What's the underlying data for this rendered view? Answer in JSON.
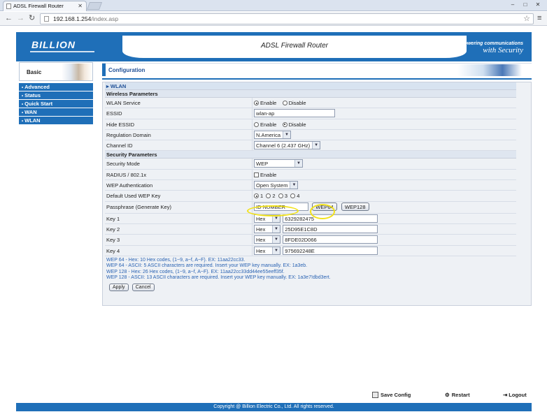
{
  "browser": {
    "tab_title": "ADSL Firewall Router",
    "url_host": "192.168.1.254",
    "url_path": "/index.asp"
  },
  "header": {
    "logo": "BILLION",
    "title": "ADSL Firewall Router",
    "slogan_line1": "Powering communications",
    "slogan_line2": "with Security"
  },
  "sidebar": {
    "title": "Basic",
    "items": [
      {
        "label": "Advanced"
      },
      {
        "label": "Status"
      },
      {
        "label": "Quick Start"
      },
      {
        "label": "WAN"
      },
      {
        "label": "WLAN"
      }
    ]
  },
  "content": {
    "title": "Configuration",
    "panel_title": "WLAN",
    "wireless_section": "Wireless Parameters",
    "security_section": "Security Parameters"
  },
  "wireless": {
    "service": {
      "label": "WLAN Service",
      "enable": "Enable",
      "disable": "Disable",
      "selected": "Enable"
    },
    "essid": {
      "label": "ESSID",
      "value": "wlan-ap"
    },
    "hide_essid": {
      "label": "Hide ESSID",
      "enable": "Enable",
      "disable": "Disable",
      "selected": "Disable"
    },
    "regulation": {
      "label": "Regulation Domain",
      "value": "N.America"
    },
    "channel": {
      "label": "Channel ID",
      "value": "Channel 6 (2.437 GHz)"
    }
  },
  "security": {
    "mode": {
      "label": "Security Mode",
      "value": "WEP"
    },
    "radius": {
      "label": "RADIUS / 802.1x",
      "option": "Enable",
      "checked": false
    },
    "wep_auth": {
      "label": "WEP Authentication",
      "value": "Open System"
    },
    "default_key": {
      "label": "Default Used WEP Key",
      "options": [
        "1",
        "2",
        "3",
        "4"
      ],
      "selected": "1"
    },
    "passphrase": {
      "label": "Passphrase (Generate Key)",
      "value": "ID NUMBER",
      "wep64": "WEP64",
      "wep128": "WEP128"
    },
    "keys": [
      {
        "label": "Key 1",
        "format": "Hex",
        "value": "6329282475"
      },
      {
        "label": "Key 2",
        "format": "Hex",
        "value": "25D95E1C8D"
      },
      {
        "label": "Key 3",
        "format": "Hex",
        "value": "8FDE02D066"
      },
      {
        "label": "Key 4",
        "format": "Hex",
        "value": "975692248E"
      }
    ]
  },
  "hints": [
    "WEP 64 - Hex: 10 Hex codes, (1~9, a~f, A~F). EX: 11aa22cc33.",
    "WEP 64 - ASCII: 5 ASCII characters are required. Insert your WEP key manually. EX: 1a3eb.",
    "WEP 128 - Hex: 26 Hex codes, (1~9, a~f, A~F). EX: 11aa22cc33dd44ee55eeff35f.",
    "WEP 128 - ASCII: 13 ASCII characters are required. Insert your WEP key manually. EX: 1a3e7!dbd3ert."
  ],
  "actions": {
    "apply": "Apply",
    "cancel": "Cancel"
  },
  "footer": {
    "save_config": "Save Config",
    "restart": "Restart",
    "logout": "Logout",
    "copyright": "Copyright @ Billion Electric Co., Ltd. All rights reserved."
  },
  "colors": {
    "brand_blue": "#1f6fb8",
    "highlight": "#f2e21a",
    "hint_text": "#2a63b3"
  }
}
